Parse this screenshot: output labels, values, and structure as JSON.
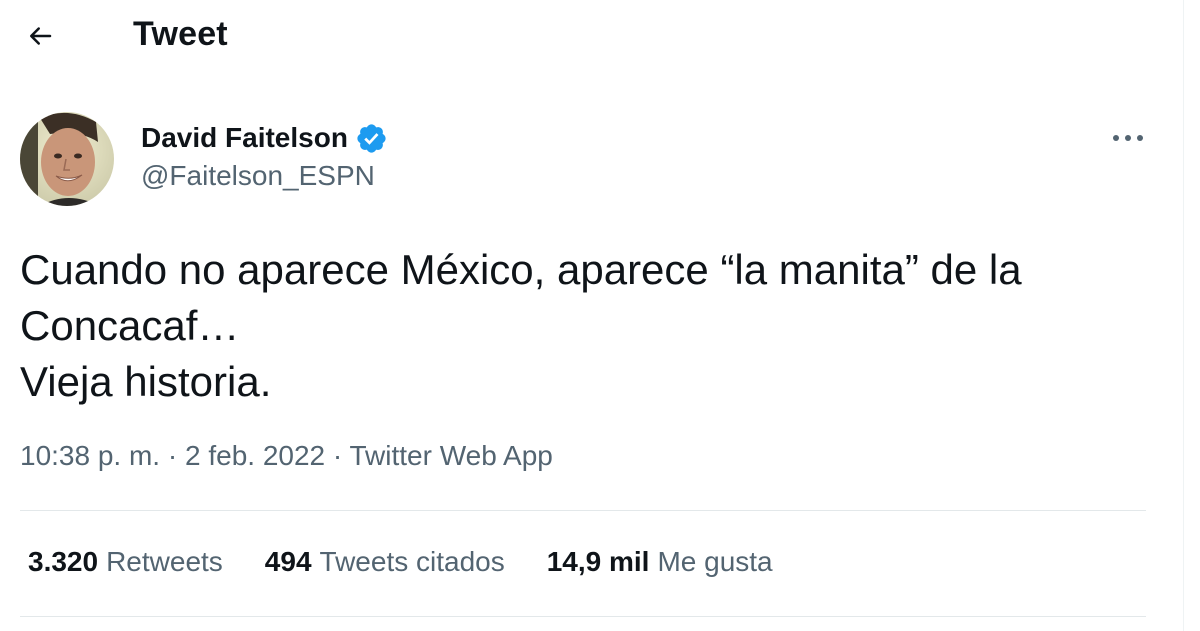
{
  "header": {
    "title": "Tweet",
    "back_icon": "arrow-left-icon"
  },
  "author": {
    "name": "David Faitelson",
    "handle": "@Faitelson_ESPN",
    "verified": true,
    "verified_icon": "verified-badge-icon",
    "avatar_icon": "avatar-photo"
  },
  "more_icon": "more-horizontal-icon",
  "tweet": {
    "lines": [
      "Cuando no aparece México, aparece “la manita” de la",
      "Concacaf…",
      "Vieja historia."
    ]
  },
  "meta": {
    "time": "10:38 p. m.",
    "separator_1": " · ",
    "date": "2 feb. 2022",
    "separator_2": " · ",
    "source": "Twitter Web App"
  },
  "stats": [
    {
      "count": "3.320",
      "label": "Retweets"
    },
    {
      "count": "494",
      "label": "Tweets citados"
    },
    {
      "count": "14,9 mil",
      "label": "Me gusta"
    }
  ],
  "colors": {
    "primary_text": "#0f1419",
    "secondary_text": "#536471",
    "verified_blue": "#1d9bf0",
    "divider": "#e3e8ea"
  }
}
